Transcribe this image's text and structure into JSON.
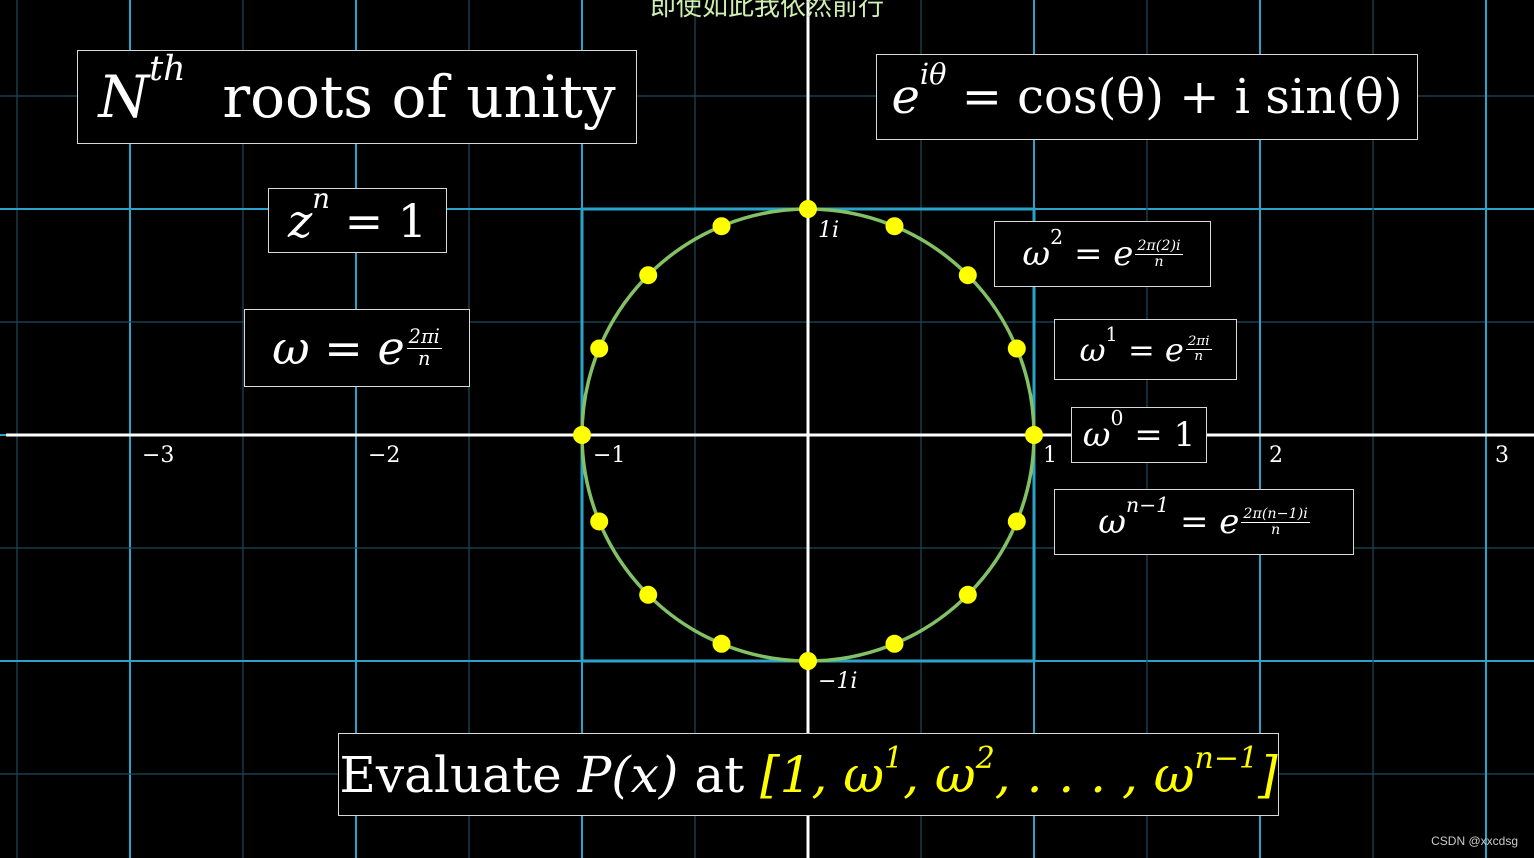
{
  "subtitle": "即使如此我依然前行",
  "watermark": "CSDN @xxcdsg",
  "title": {
    "base": "N",
    "sup": "th",
    "rest": "roots of unity"
  },
  "euler": {
    "lhs": "e",
    "lhs_sup": "iθ",
    "rhs": "= cos(θ) + i sin(θ)"
  },
  "equation_zn": {
    "base": "z",
    "sup": "n",
    "rhs": "= 1"
  },
  "omega_def": {
    "lhs": "ω = e",
    "num": "2πi",
    "den": "n"
  },
  "omega2": {
    "base": "ω",
    "sup": "2",
    "mid": "= e",
    "num": "2π(2)i",
    "den": "n"
  },
  "omega1": {
    "base": "ω",
    "sup": "1",
    "mid": "= e",
    "num": "2πi",
    "den": "n"
  },
  "omega0": {
    "base": "ω",
    "sup": "0",
    "rhs": "= 1"
  },
  "omegan1": {
    "base": "ω",
    "sup": "n−1",
    "mid": "= e",
    "num": "2π(n−1)i",
    "den": "n"
  },
  "evaluate": {
    "prefix": "Evaluate",
    "fn": "P(x)",
    "at": "at",
    "list_open": "[1, ω",
    "s1": "1",
    "c1": ", ω",
    "s2": "2",
    "c2": ", . . . , ω",
    "s3": "n−1",
    "list_close": "]"
  },
  "axis": {
    "x_ticks": [
      "−3",
      "−2",
      "−1",
      "1",
      "2",
      "3"
    ],
    "y_ticks": [
      "1i",
      "−1i"
    ]
  },
  "roots_count": 16,
  "colors": {
    "grid_major": "#29a3c9",
    "grid_minor": "#1d4a5a",
    "circle": "#83c167",
    "roots": "#ffff00",
    "axes": "#ffffff",
    "highlight": "#ffff00"
  }
}
